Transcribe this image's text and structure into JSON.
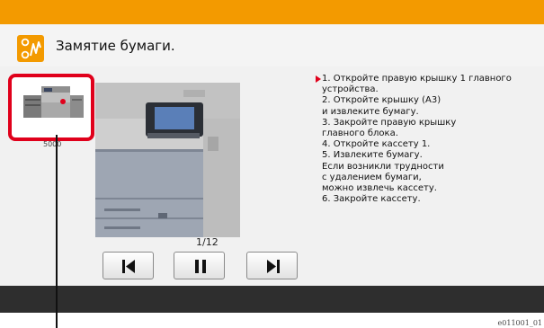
{
  "header": {
    "title": "Замятие бумаги.",
    "icon": "paper-jam-icon",
    "accent_color": "#f39a00"
  },
  "thumbnail": {
    "caption": "5000",
    "highlight_color": "#e0001b"
  },
  "navigation": {
    "counter": "1/12",
    "buttons": [
      "skip-back-icon",
      "pause-icon",
      "skip-forward-icon"
    ]
  },
  "instructions": {
    "lines": [
      "1. Откройте правую крышку 1 главного",
      "устройства.",
      "2. Откройте крышку (A3)",
      "и извлеките бумагу.",
      "3. Закройте правую крышку",
      "главного блока.",
      "4. Откройте кассету 1.",
      "5. Извлеките бумагу.",
      "Если возникли трудности",
      "с удалением бумаги,",
      "можно извлечь кассету.",
      "6. Закройте кассету."
    ]
  },
  "footer": {
    "reference_code": "e011001_01"
  }
}
